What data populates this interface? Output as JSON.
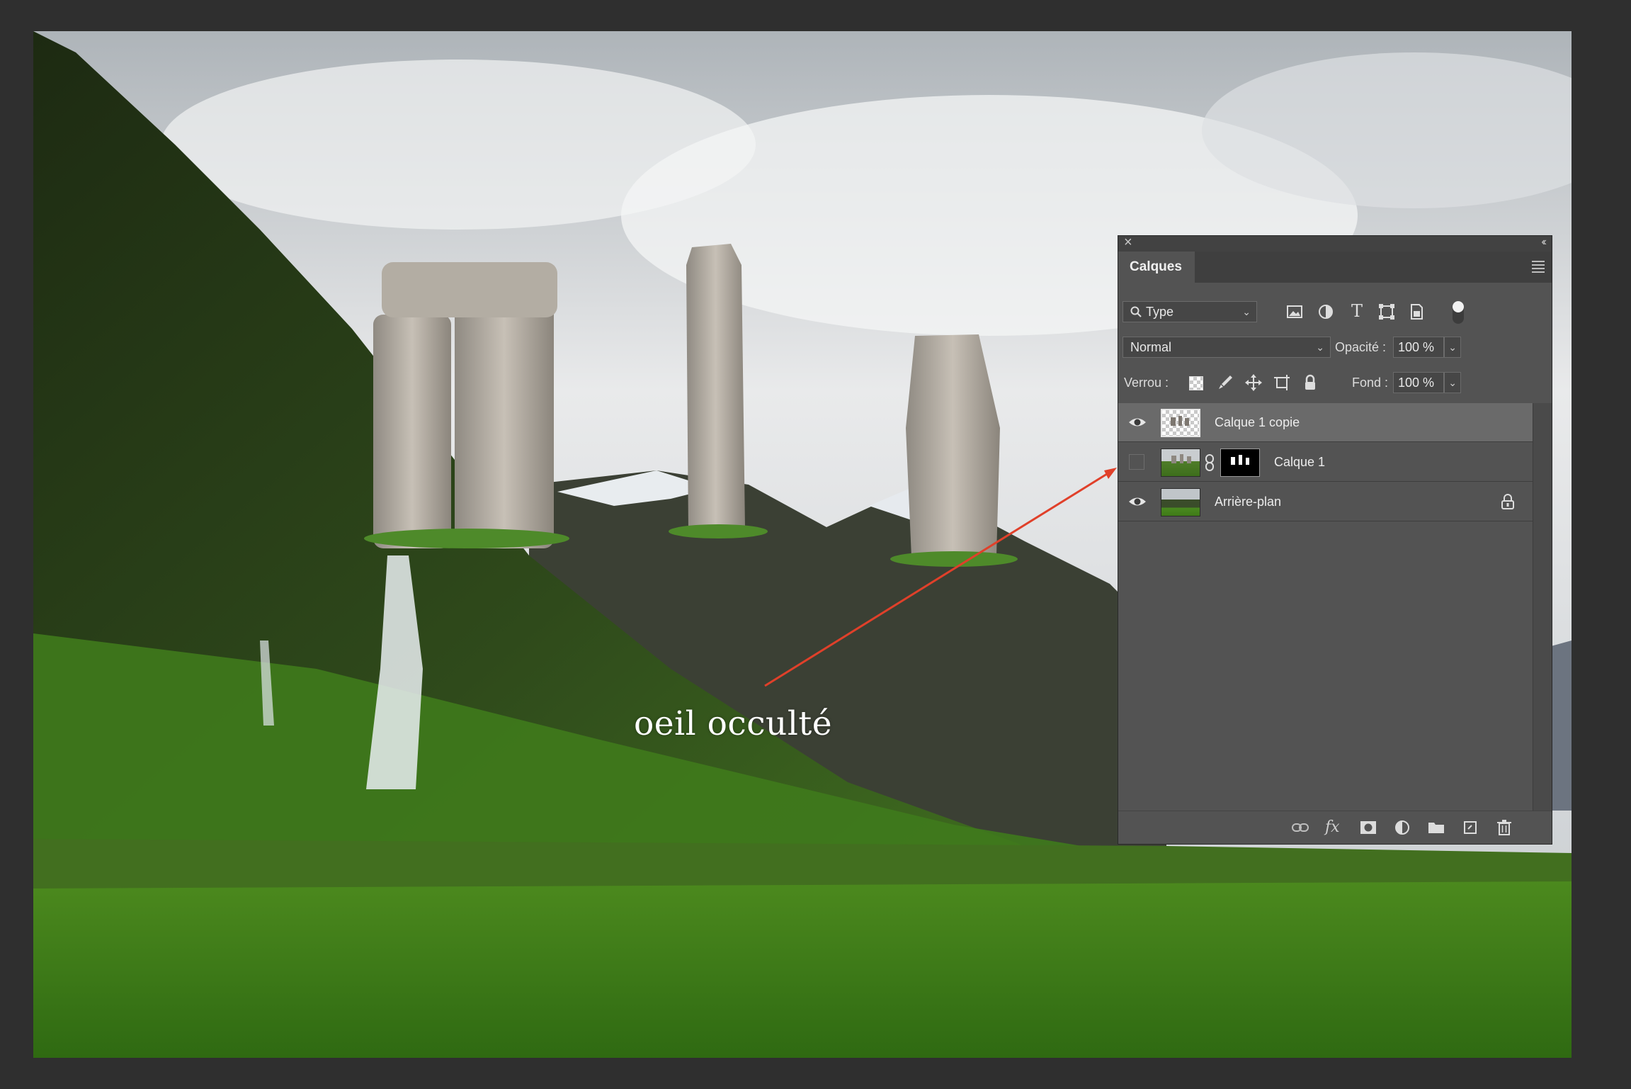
{
  "annotation": {
    "text": "oeil occulté"
  },
  "layers_panel": {
    "tab": "Calques",
    "filter": {
      "label": "Type"
    },
    "blend_mode": {
      "value": "Normal"
    },
    "opacity": {
      "label": "Opacité :",
      "value": "100 %"
    },
    "lock": {
      "label": "Verrou :"
    },
    "fill": {
      "label": "Fond :",
      "value": "100 %"
    },
    "layers": [
      {
        "name": "Calque 1 copie",
        "visible": true,
        "selected": true
      },
      {
        "name": "Calque 1",
        "visible": false,
        "selected": false,
        "has_mask": true
      },
      {
        "name": "Arrière-plan",
        "visible": true,
        "selected": false,
        "locked": true
      }
    ]
  },
  "colors": {
    "panel_bg": "#535353",
    "selected_row": "#6a6a6a",
    "arrow": "#e0402a"
  }
}
